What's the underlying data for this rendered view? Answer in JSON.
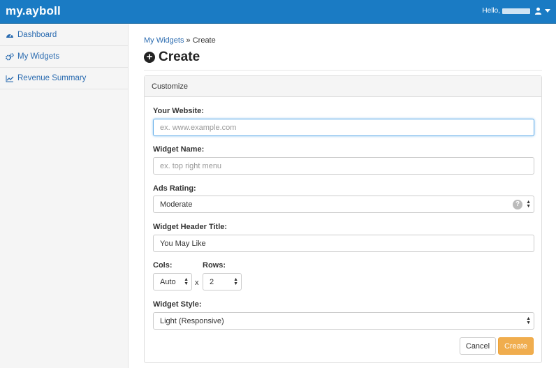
{
  "header": {
    "logo": "my.ayboll",
    "greeting": "Hello,"
  },
  "sidebar": {
    "items": [
      {
        "label": "Dashboard",
        "icon": "dashboard-icon"
      },
      {
        "label": "My Widgets",
        "icon": "cogs-icon"
      },
      {
        "label": "Revenue Summary",
        "icon": "line-chart-icon"
      }
    ]
  },
  "breadcrumb": {
    "link": "My Widgets",
    "separator": "»",
    "current": "Create"
  },
  "page": {
    "title": "Create"
  },
  "panel": {
    "heading": "Customize"
  },
  "form": {
    "website": {
      "label": "Your Website:",
      "placeholder": "ex. www.example.com",
      "value": ""
    },
    "widget_name": {
      "label": "Widget Name:",
      "placeholder": "ex. top right menu",
      "value": ""
    },
    "ads_rating": {
      "label": "Ads Rating:",
      "value": "Moderate",
      "help": "?"
    },
    "header_title": {
      "label": "Widget Header Title:",
      "value": "You May Like"
    },
    "cols": {
      "label": "Cols:",
      "value": "Auto"
    },
    "times": "x",
    "rows": {
      "label": "Rows:",
      "value": "2"
    },
    "widget_style": {
      "label": "Widget Style:",
      "value": "Light (Responsive)"
    },
    "cancel_label": "Cancel",
    "create_label": "Create"
  },
  "colors": {
    "topbar": "#1a7bc4",
    "link": "#2a6bb0",
    "create_button": "#f0ad4e"
  }
}
